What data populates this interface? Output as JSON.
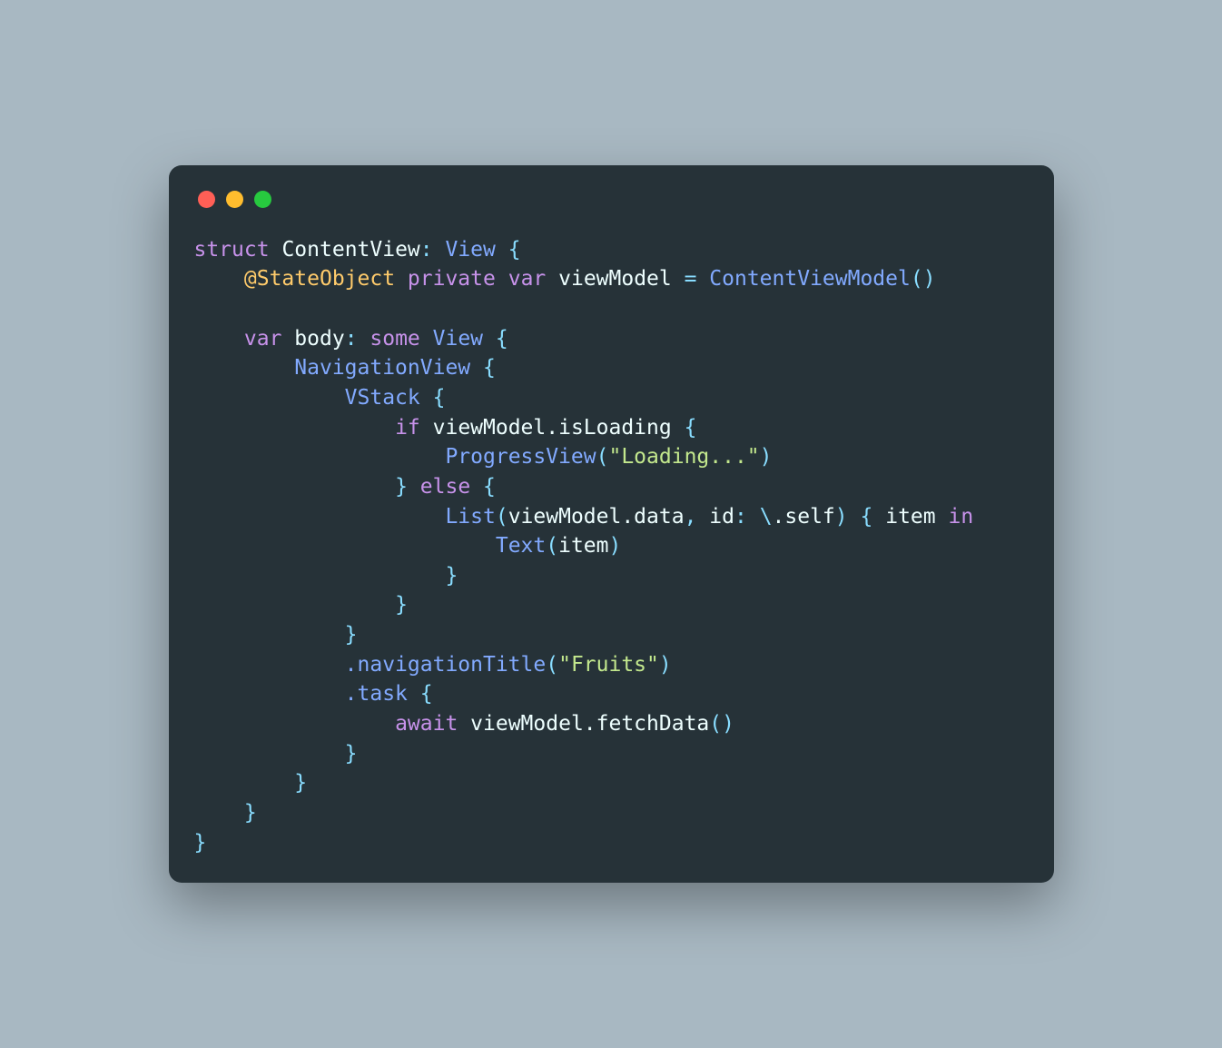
{
  "traffic": {
    "red": "#ff5f56",
    "yellow": "#ffbd2e",
    "green": "#27c93f"
  },
  "code": {
    "t": {
      "struct": "struct",
      "contentview": "ContentView",
      "colon_view": ": ",
      "view": "View",
      "lbrace": " {",
      "stateobject": "@StateObject",
      "private": "private",
      "var": "var",
      "viewmodel": "viewModel",
      "eq": " = ",
      "contentviewmodel": "ContentViewModel",
      "parens": "()",
      "body": "body",
      "colon": ": ",
      "some": "some",
      "navview": "NavigationView",
      "vstack": "VStack",
      "if": "if",
      "vm_isloading": "viewModel.isLoading",
      "progressview": "ProgressView",
      "loading_str": "\"Loading...\"",
      "rparen": ")",
      "rbrace": "}",
      "else": "else",
      "list": "List",
      "lparen": "(",
      "vm_data": "viewModel.data",
      "comma_id": ", ",
      "id_label": "id",
      "colon_arg": ": ",
      "backslash": "\\",
      "dot_self": ".self",
      "item": "item",
      "in": "in",
      "text": "Text",
      "item_arg": "item",
      "dot_navtitle": ".navigationTitle",
      "fruits_str": "\"Fruits\"",
      "dot_task": ".task",
      "await": "await",
      "vm_fetch": "viewModel.fetchData",
      "space": " "
    }
  }
}
